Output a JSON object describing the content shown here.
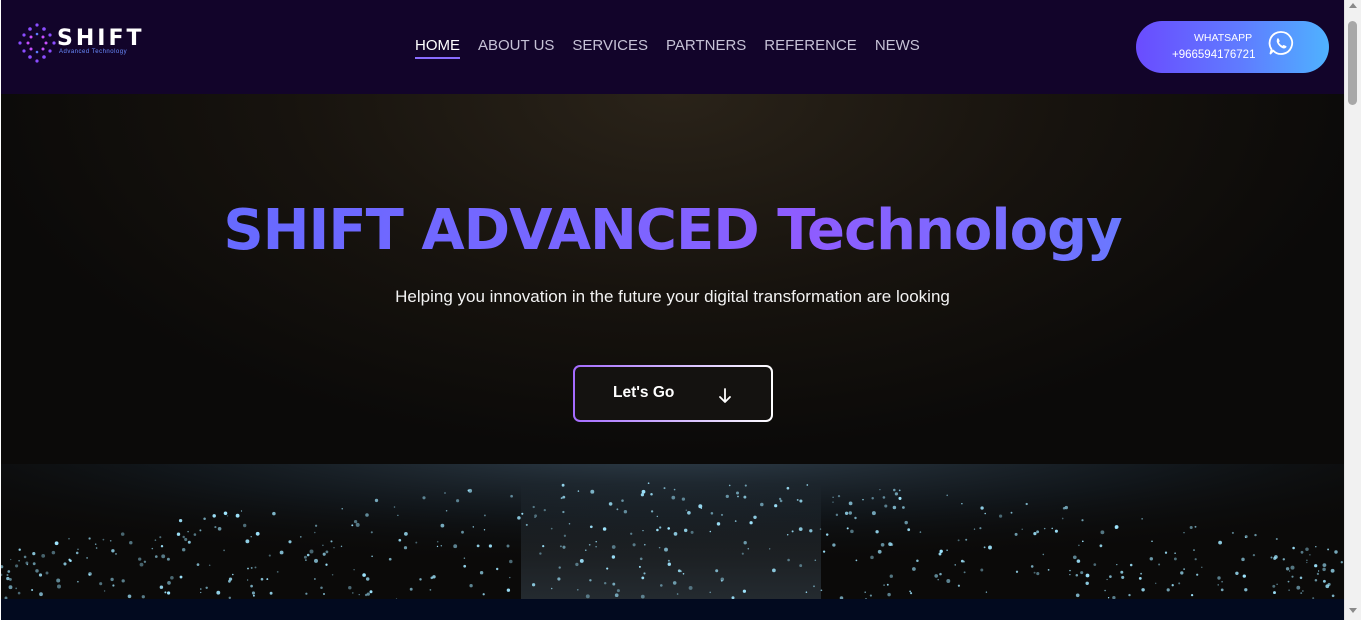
{
  "header": {
    "logo": {
      "word": "SHIFT",
      "tagline": "Advanced Technology",
      "icon": "dot-circuit-logo-icon"
    },
    "nav": [
      {
        "label": "HOME",
        "active": true
      },
      {
        "label": "ABOUT US",
        "active": false
      },
      {
        "label": "SERVICES",
        "active": false
      },
      {
        "label": "PARTNERS",
        "active": false
      },
      {
        "label": "REFERENCE",
        "active": false
      },
      {
        "label": "NEWS",
        "active": false
      }
    ],
    "whatsapp": {
      "title": "WHATSAPP",
      "phone": "+966594176721",
      "icon": "whatsapp-icon"
    }
  },
  "hero": {
    "title": "SHIFT ADVANCED Technology",
    "subtitle": "Helping you innovation in the future your digital transformation are looking",
    "cta": {
      "label": "Let's Go",
      "icon": "arrow-down-icon"
    }
  },
  "colors": {
    "header_bg": "#12042a",
    "accent_purple": "#8a6cff",
    "accent_blue": "#4fb2ff",
    "particle": "#8fe3ff"
  }
}
